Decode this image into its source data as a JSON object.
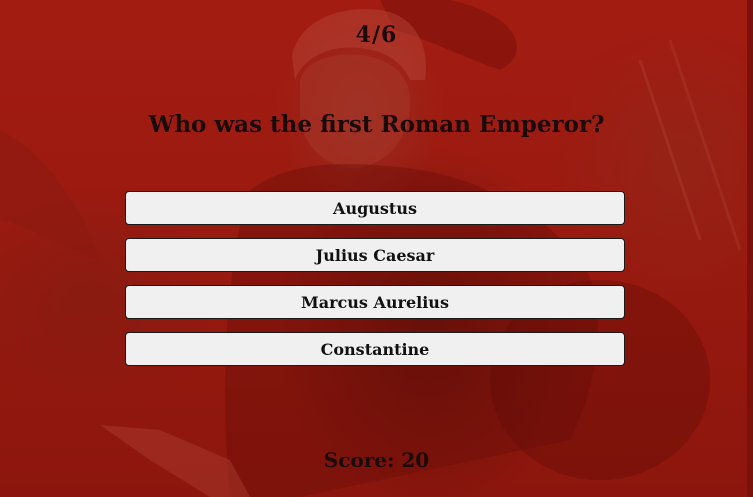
{
  "quiz": {
    "progress": "4/6",
    "question": "Who was the first Roman Emperor?",
    "options": [
      {
        "label": "Augustus"
      },
      {
        "label": "Julius Caesar"
      },
      {
        "label": "Marcus Aurelius"
      },
      {
        "label": "Constantine"
      }
    ],
    "score": "Score: 20"
  },
  "colors": {
    "background": "#9c1a10",
    "button_bg": "#f0f0f0",
    "text": "#1a0b08"
  }
}
